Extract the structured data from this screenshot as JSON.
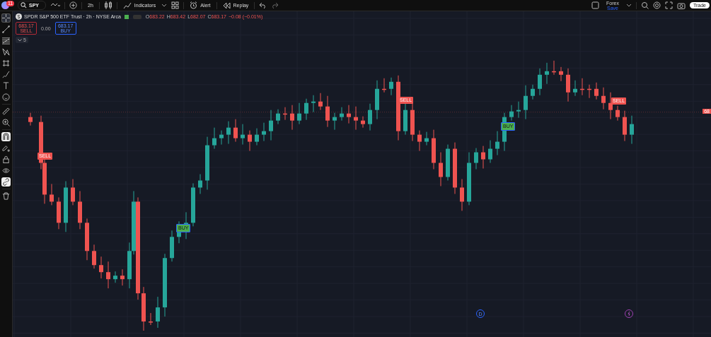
{
  "topbar": {
    "badge": "11",
    "symbol": "SPY",
    "interval": "2h",
    "indicators": "Indicators",
    "alert": "Alert",
    "replay": "Replay",
    "layout": "Forex",
    "layout_status": "Save",
    "trade": "Trade"
  },
  "tools": [
    {
      "kind": "crosshair",
      "selected": true,
      "on": false
    },
    {
      "kind": "trendline",
      "selected": false,
      "on": false
    },
    {
      "kind": "fib",
      "selected": false,
      "on": false
    },
    {
      "kind": "pattern",
      "selected": false,
      "on": false
    },
    {
      "kind": "forecast",
      "selected": false,
      "on": false
    },
    {
      "kind": "brush",
      "selected": false,
      "on": false
    },
    {
      "kind": "text",
      "selected": false,
      "on": false
    },
    {
      "kind": "emoji",
      "selected": false,
      "on": false
    },
    {
      "kind": "ruler",
      "selected": false,
      "on": false
    },
    {
      "kind": "zoom",
      "selected": false,
      "on": false
    },
    {
      "kind": "magnet",
      "selected": false,
      "on": true
    },
    {
      "kind": "stay",
      "selected": false,
      "on": false
    },
    {
      "kind": "lock",
      "selected": false,
      "on": false
    },
    {
      "kind": "eye",
      "selected": false,
      "on": false
    },
    {
      "kind": "link",
      "selected": false,
      "on": true
    },
    {
      "kind": "trash",
      "selected": false,
      "on": false
    }
  ],
  "legend": {
    "title": "SPDR S&P 500 ETF Trust · 2h · NYSE Arca",
    "ohlc": [
      {
        "label": "O",
        "value": "683.22"
      },
      {
        "label": "H",
        "value": "683.42"
      },
      {
        "label": "L",
        "value": "682.07"
      },
      {
        "label": "C",
        "value": "683.17"
      }
    ],
    "change": "−0.08 (−0.01%)"
  },
  "order": {
    "sell": {
      "price": "683.17",
      "label": "SELL"
    },
    "spread": "0.00",
    "buy": {
      "price": "683.17",
      "label": "BUY"
    }
  },
  "indicators_toggle": "5",
  "signals": [
    {
      "kind": "sell",
      "label": "SELL"
    },
    {
      "kind": "buy",
      "label": "BUY"
    },
    {
      "kind": "sell",
      "label": "SELL"
    },
    {
      "kind": "buy",
      "label": "BUY"
    },
    {
      "kind": "sell",
      "label": "SELL"
    }
  ],
  "price_label": "68",
  "events": [
    {
      "kind": "dividend",
      "label": "D"
    },
    {
      "kind": "earnings"
    }
  ]
}
